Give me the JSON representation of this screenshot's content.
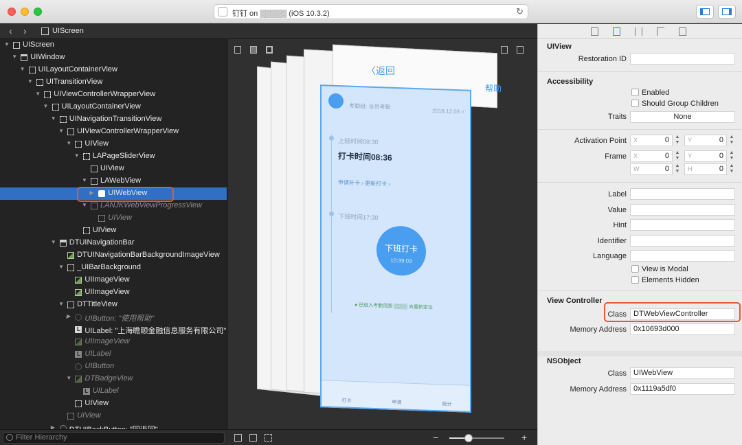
{
  "window": {
    "title": "钉钉 on ▒▒▒▒▒ (iOS 10.3.2)",
    "panel_toggle_left": "left-panel",
    "panel_toggle_right": "right-panel"
  },
  "jumpbar": {
    "back": "‹",
    "forward": "›",
    "crumb": "UIScreen"
  },
  "hierarchy": [
    {
      "label": "UIScreen",
      "depth": 0,
      "icon": "solid",
      "disclosure": "▼"
    },
    {
      "label": "UIWindow",
      "depth": 1,
      "icon": "win",
      "disclosure": "▼"
    },
    {
      "label": "UILayoutContainerView",
      "depth": 2,
      "icon": "dash",
      "disclosure": "▼"
    },
    {
      "label": "UITransitionView",
      "depth": 3,
      "icon": "dash",
      "disclosure": "▼"
    },
    {
      "label": "UIViewControllerWrapperView",
      "depth": 4,
      "icon": "dash",
      "disclosure": "▼"
    },
    {
      "label": "UILayoutContainerView",
      "depth": 5,
      "icon": "dash",
      "disclosure": "▼"
    },
    {
      "label": "UINavigationTransitionView",
      "depth": 6,
      "icon": "dash",
      "disclosure": "▼"
    },
    {
      "label": "UIViewControllerWrapperView",
      "depth": 7,
      "icon": "dash",
      "disclosure": "▼"
    },
    {
      "label": "UIView",
      "depth": 8,
      "icon": "dash",
      "disclosure": "▼"
    },
    {
      "label": "LAPageSliderView",
      "depth": 9,
      "icon": "dash",
      "disclosure": "▼"
    },
    {
      "label": "UIView",
      "depth": 10,
      "icon": "dash",
      "disclosure": ""
    },
    {
      "label": "LAWebView",
      "depth": 10,
      "icon": "dash",
      "disclosure": "▼"
    },
    {
      "label": "UIWebView",
      "depth": 11,
      "icon": "web",
      "disclosure": "▶",
      "selected": true
    },
    {
      "label": "LANJKWebViewProgressView",
      "depth": 10,
      "icon": "dash",
      "disclosure": "▼",
      "dim": true
    },
    {
      "label": "UIView",
      "depth": 11,
      "icon": "dash",
      "disclosure": "",
      "dim": true
    },
    {
      "label": "UIView",
      "depth": 9,
      "icon": "dash",
      "disclosure": ""
    },
    {
      "label": "DTUINavigationBar",
      "depth": 6,
      "icon": "bar",
      "disclosure": "▼"
    },
    {
      "label": "DTUINavigationBarBackgroundImageView",
      "depth": 7,
      "icon": "img",
      "disclosure": ""
    },
    {
      "label": "_UIBarBackground",
      "depth": 7,
      "icon": "dash",
      "disclosure": "▼"
    },
    {
      "label": "UIImageView",
      "depth": 8,
      "icon": "img",
      "disclosure": ""
    },
    {
      "label": "UIImageView",
      "depth": 8,
      "icon": "img",
      "disclosure": ""
    },
    {
      "label": "DTTitleView",
      "depth": 7,
      "icon": "dash",
      "disclosure": "▼"
    },
    {
      "label": "UIButton: \"使用帮助\"",
      "depth": 8,
      "icon": "btn",
      "disclosure": "▶",
      "dim": true
    },
    {
      "label": "UILabel: \"上海瞻颐金融信息服务有限公司\"",
      "depth": 8,
      "icon": "lbl",
      "disclosure": ""
    },
    {
      "label": "UIImageView",
      "depth": 8,
      "icon": "img",
      "disclosure": "",
      "dim": true
    },
    {
      "label": "UILabel",
      "depth": 8,
      "icon": "lbl",
      "disclosure": "",
      "dim": true
    },
    {
      "label": "UIButton",
      "depth": 8,
      "icon": "btn",
      "disclosure": "",
      "dim": true
    },
    {
      "label": "DTBadgeView",
      "depth": 8,
      "icon": "img",
      "disclosure": "▼",
      "dim": true
    },
    {
      "label": "UILabel",
      "depth": 9,
      "icon": "lbl",
      "disclosure": "",
      "dim": true
    },
    {
      "label": "UIView",
      "depth": 8,
      "icon": "dash",
      "disclosure": ""
    },
    {
      "label": "UIView",
      "depth": 7,
      "icon": "dash",
      "disclosure": "",
      "dim": true
    },
    {
      "label": "DTUIBackButton: \"回返回\"",
      "depth": 6,
      "icon": "btn",
      "disclosure": "▶"
    }
  ],
  "filter": {
    "placeholder": "Filter Hierarchy"
  },
  "canvas": {
    "nav_back": "〈返回",
    "nav_help": "帮助",
    "group": "考勤组: 全员考勤",
    "date": "2018.12.03 ˅",
    "clock_in_time": "上班时间08:30",
    "clock_in_record": "打卡时间08:36",
    "actions": "申请补卡 ›    更新打卡 ›",
    "clock_out_time": "下班时间17:30",
    "clock_button": "下班打卡",
    "clock_button_time": "10:39:03",
    "location": "● 已进入考勤范围 ▒▒▒▒ 去重新定位",
    "tabs": [
      "打卡",
      "申请",
      "统计"
    ]
  },
  "canvas_bar": {
    "zoom_minus": "−",
    "zoom_plus": "+",
    "zoom_level": 0.35
  },
  "inspector": {
    "uiview": {
      "title": "UIView",
      "restoration_id_label": "Restoration ID",
      "restoration_id": ""
    },
    "accessibility": {
      "title": "Accessibility",
      "enabled_label": "Enabled",
      "group_children_label": "Should Group Children",
      "traits_label": "Traits",
      "traits": "None",
      "activation_point_label": "Activation Point",
      "activation_x": "0",
      "activation_y": "0",
      "frame_label": "Frame",
      "frame_x": "0",
      "frame_y": "0",
      "frame_w": "0",
      "frame_h": "0",
      "label_label": "Label",
      "value_label": "Value",
      "hint_label": "Hint",
      "identifier_label": "Identifier",
      "language_label": "Language",
      "modal_label": "View is Modal",
      "hidden_label": "Elements Hidden"
    },
    "view_controller": {
      "title": "View Controller",
      "class_label": "Class",
      "class": "DTWebViewController",
      "memory_label": "Memory Address",
      "memory": "0x10693d000"
    },
    "nsobject": {
      "title": "NSObject",
      "class_label": "Class",
      "class": "UIWebView",
      "memory_label": "Memory Address",
      "memory": "0x1119a5df0"
    },
    "prefix": {
      "x": "X",
      "y": "Y",
      "w": "W",
      "h": "H"
    }
  }
}
